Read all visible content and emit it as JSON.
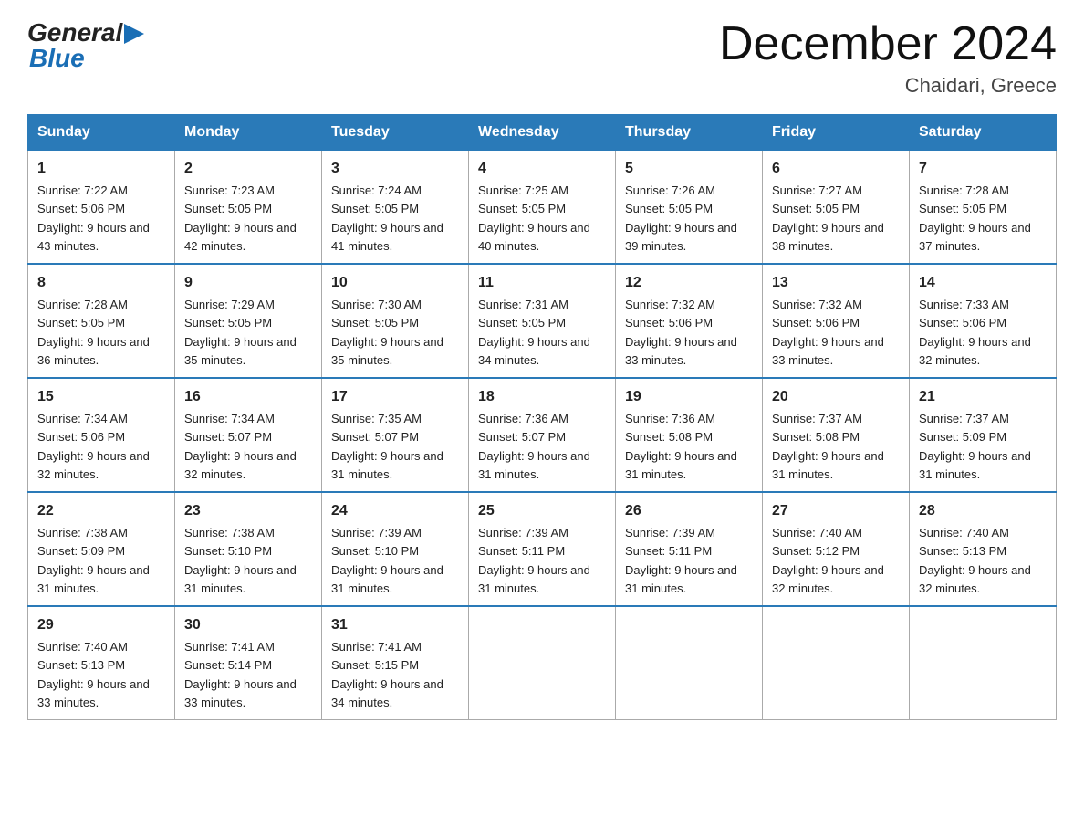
{
  "header": {
    "logo_general": "General",
    "logo_blue": "Blue",
    "month_title": "December 2024",
    "location": "Chaidari, Greece"
  },
  "columns": [
    "Sunday",
    "Monday",
    "Tuesday",
    "Wednesday",
    "Thursday",
    "Friday",
    "Saturday"
  ],
  "weeks": [
    [
      {
        "day": "1",
        "sunrise": "7:22 AM",
        "sunset": "5:06 PM",
        "daylight": "9 hours and 43 minutes."
      },
      {
        "day": "2",
        "sunrise": "7:23 AM",
        "sunset": "5:05 PM",
        "daylight": "9 hours and 42 minutes."
      },
      {
        "day": "3",
        "sunrise": "7:24 AM",
        "sunset": "5:05 PM",
        "daylight": "9 hours and 41 minutes."
      },
      {
        "day": "4",
        "sunrise": "7:25 AM",
        "sunset": "5:05 PM",
        "daylight": "9 hours and 40 minutes."
      },
      {
        "day": "5",
        "sunrise": "7:26 AM",
        "sunset": "5:05 PM",
        "daylight": "9 hours and 39 minutes."
      },
      {
        "day": "6",
        "sunrise": "7:27 AM",
        "sunset": "5:05 PM",
        "daylight": "9 hours and 38 minutes."
      },
      {
        "day": "7",
        "sunrise": "7:28 AM",
        "sunset": "5:05 PM",
        "daylight": "9 hours and 37 minutes."
      }
    ],
    [
      {
        "day": "8",
        "sunrise": "7:28 AM",
        "sunset": "5:05 PM",
        "daylight": "9 hours and 36 minutes."
      },
      {
        "day": "9",
        "sunrise": "7:29 AM",
        "sunset": "5:05 PM",
        "daylight": "9 hours and 35 minutes."
      },
      {
        "day": "10",
        "sunrise": "7:30 AM",
        "sunset": "5:05 PM",
        "daylight": "9 hours and 35 minutes."
      },
      {
        "day": "11",
        "sunrise": "7:31 AM",
        "sunset": "5:05 PM",
        "daylight": "9 hours and 34 minutes."
      },
      {
        "day": "12",
        "sunrise": "7:32 AM",
        "sunset": "5:06 PM",
        "daylight": "9 hours and 33 minutes."
      },
      {
        "day": "13",
        "sunrise": "7:32 AM",
        "sunset": "5:06 PM",
        "daylight": "9 hours and 33 minutes."
      },
      {
        "day": "14",
        "sunrise": "7:33 AM",
        "sunset": "5:06 PM",
        "daylight": "9 hours and 32 minutes."
      }
    ],
    [
      {
        "day": "15",
        "sunrise": "7:34 AM",
        "sunset": "5:06 PM",
        "daylight": "9 hours and 32 minutes."
      },
      {
        "day": "16",
        "sunrise": "7:34 AM",
        "sunset": "5:07 PM",
        "daylight": "9 hours and 32 minutes."
      },
      {
        "day": "17",
        "sunrise": "7:35 AM",
        "sunset": "5:07 PM",
        "daylight": "9 hours and 31 minutes."
      },
      {
        "day": "18",
        "sunrise": "7:36 AM",
        "sunset": "5:07 PM",
        "daylight": "9 hours and 31 minutes."
      },
      {
        "day": "19",
        "sunrise": "7:36 AM",
        "sunset": "5:08 PM",
        "daylight": "9 hours and 31 minutes."
      },
      {
        "day": "20",
        "sunrise": "7:37 AM",
        "sunset": "5:08 PM",
        "daylight": "9 hours and 31 minutes."
      },
      {
        "day": "21",
        "sunrise": "7:37 AM",
        "sunset": "5:09 PM",
        "daylight": "9 hours and 31 minutes."
      }
    ],
    [
      {
        "day": "22",
        "sunrise": "7:38 AM",
        "sunset": "5:09 PM",
        "daylight": "9 hours and 31 minutes."
      },
      {
        "day": "23",
        "sunrise": "7:38 AM",
        "sunset": "5:10 PM",
        "daylight": "9 hours and 31 minutes."
      },
      {
        "day": "24",
        "sunrise": "7:39 AM",
        "sunset": "5:10 PM",
        "daylight": "9 hours and 31 minutes."
      },
      {
        "day": "25",
        "sunrise": "7:39 AM",
        "sunset": "5:11 PM",
        "daylight": "9 hours and 31 minutes."
      },
      {
        "day": "26",
        "sunrise": "7:39 AM",
        "sunset": "5:11 PM",
        "daylight": "9 hours and 31 minutes."
      },
      {
        "day": "27",
        "sunrise": "7:40 AM",
        "sunset": "5:12 PM",
        "daylight": "9 hours and 32 minutes."
      },
      {
        "day": "28",
        "sunrise": "7:40 AM",
        "sunset": "5:13 PM",
        "daylight": "9 hours and 32 minutes."
      }
    ],
    [
      {
        "day": "29",
        "sunrise": "7:40 AM",
        "sunset": "5:13 PM",
        "daylight": "9 hours and 33 minutes."
      },
      {
        "day": "30",
        "sunrise": "7:41 AM",
        "sunset": "5:14 PM",
        "daylight": "9 hours and 33 minutes."
      },
      {
        "day": "31",
        "sunrise": "7:41 AM",
        "sunset": "5:15 PM",
        "daylight": "9 hours and 34 minutes."
      },
      null,
      null,
      null,
      null
    ]
  ]
}
